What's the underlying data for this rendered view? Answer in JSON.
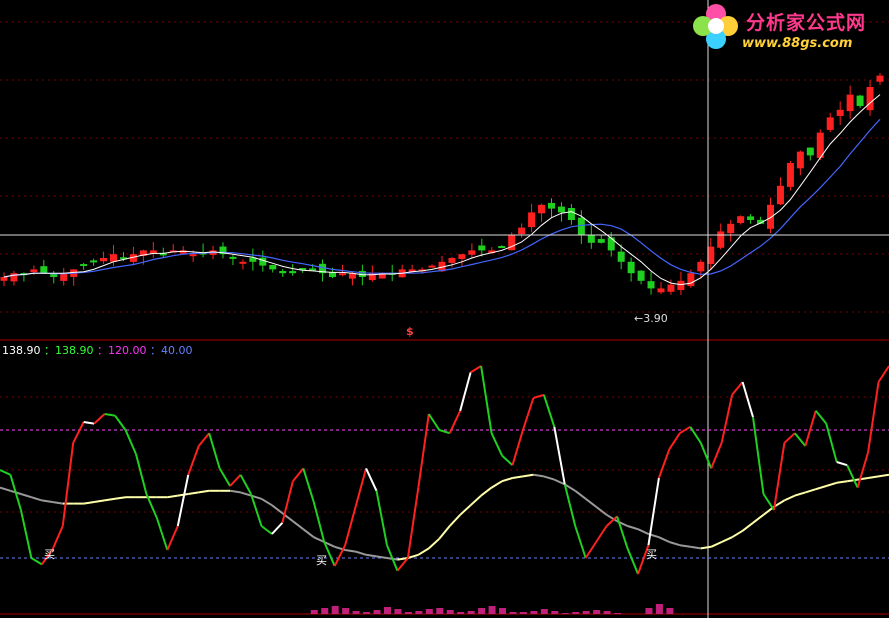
{
  "watermark": {
    "title": "分析家公式网",
    "url": "www.88gs.com",
    "logo": "flower-logo"
  },
  "main_panel": {
    "min_label": "←3.90",
    "marker_text": "$"
  },
  "indicator_panel": {
    "values": [
      {
        "text": "138.90",
        "color": "#ffffff"
      },
      {
        "text": "：138.90",
        "color": "#33ff33"
      },
      {
        "text": "：120.00",
        "color": "#ff33ff"
      },
      {
        "text": "：40.00",
        "color": "#6680ff"
      }
    ],
    "buy_labels": [
      "买",
      "买",
      "买"
    ]
  },
  "colors": {
    "up": "#ff2020",
    "down": "#20d020",
    "ma_short": "#ffffff",
    "ma_long": "#4466ff",
    "ref_line": "#ff44ff",
    "ref_line2": "#6680ff",
    "signal": "#ffffaa",
    "volume": "#c0207a",
    "crosshair": "#dddddd",
    "grid": "#7a0000"
  },
  "chart_data": [
    {
      "type": "candlestick",
      "title": "",
      "close_trend": [
        3.95,
        3.96,
        3.96,
        3.97,
        3.96,
        3.95,
        3.96,
        3.97,
        3.98,
        3.99,
        4.0,
        4.01,
        4.0,
        4.01,
        4.02,
        4.02,
        4.01,
        4.02,
        4.02,
        4.01,
        4.01,
        4.02,
        4.01,
        4.0,
        3.99,
        3.99,
        3.98,
        3.97,
        3.96,
        3.96,
        3.97,
        3.97,
        3.96,
        3.95,
        3.96,
        3.96,
        3.95,
        3.96,
        3.96,
        3.96,
        3.97,
        3.97,
        3.97,
        3.98,
        3.99,
        4.0,
        4.01,
        4.02,
        4.02,
        4.02,
        4.03,
        4.06,
        4.08,
        4.12,
        4.14,
        4.13,
        4.12,
        4.1,
        4.06,
        4.04,
        4.04,
        4.02,
        3.99,
        3.96,
        3.94,
        3.92,
        3.92,
        3.93,
        3.94,
        3.96,
        3.99,
        4.03,
        4.07,
        4.09,
        4.11,
        4.1,
        4.09,
        4.14,
        4.19,
        4.25,
        4.28,
        4.27,
        4.33,
        4.37,
        4.39,
        4.43,
        4.4,
        4.45,
        4.48
      ],
      "low": 3.9,
      "moving_averages": [
        "short",
        "long"
      ]
    },
    {
      "type": "line",
      "title": "",
      "reference_lines": [
        138.9,
        120.0,
        40.0
      ],
      "oscillator": [
        95,
        92,
        70,
        40,
        36,
        45,
        60,
        112,
        125,
        124,
        130,
        129,
        120,
        105,
        80,
        65,
        45,
        60,
        92,
        110,
        118,
        96,
        85,
        92,
        80,
        60,
        55,
        62,
        88,
        96,
        75,
        50,
        35,
        48,
        72,
        96,
        82,
        48,
        32,
        40,
        84,
        130,
        120,
        118,
        132,
        156,
        160,
        118,
        104,
        98,
        120,
        140,
        142,
        122,
        86,
        60,
        40,
        50,
        60,
        66,
        46,
        30,
        48,
        90,
        108,
        118,
        122,
        112,
        96,
        112,
        142,
        150,
        128,
        80,
        70,
        112,
        118,
        110,
        132,
        124,
        100,
        98,
        84,
        106,
        150,
        160
      ],
      "signal": [
        84,
        82,
        80,
        78,
        76,
        75,
        74,
        74,
        74,
        75,
        76,
        77,
        78,
        78,
        78,
        78,
        78,
        79,
        80,
        81,
        82,
        82,
        82,
        81,
        79,
        77,
        73,
        68,
        63,
        58,
        53,
        50,
        47,
        45,
        44,
        42,
        41,
        40,
        39,
        40,
        42,
        46,
        52,
        60,
        67,
        73,
        79,
        84,
        88,
        90,
        91,
        92,
        91,
        89,
        86,
        82,
        77,
        72,
        67,
        63,
        60,
        58,
        55,
        53,
        50,
        48,
        47,
        46,
        47,
        50,
        53,
        57,
        62,
        67,
        72,
        76,
        79,
        81,
        83,
        85,
        87,
        88,
        89,
        90,
        91,
        92
      ],
      "volume": [
        0,
        0,
        0,
        0,
        0,
        0,
        0,
        0,
        0,
        0,
        0,
        0,
        0,
        0,
        0,
        0,
        0,
        0,
        0,
        0,
        0,
        0,
        0,
        0,
        0,
        0,
        0,
        0,
        0,
        0,
        4,
        6,
        8,
        6,
        3,
        2,
        4,
        7,
        5,
        2,
        3,
        5,
        6,
        4,
        2,
        3,
        6,
        8,
        6,
        2,
        2,
        3,
        5,
        3,
        1,
        2,
        3,
        4,
        3,
        1,
        0,
        0,
        6,
        10,
        6,
        0,
        0,
        0,
        0,
        0,
        0,
        0,
        0,
        0,
        0,
        0,
        0,
        0,
        0,
        0,
        0,
        0,
        0,
        0,
        0,
        0
      ]
    }
  ]
}
